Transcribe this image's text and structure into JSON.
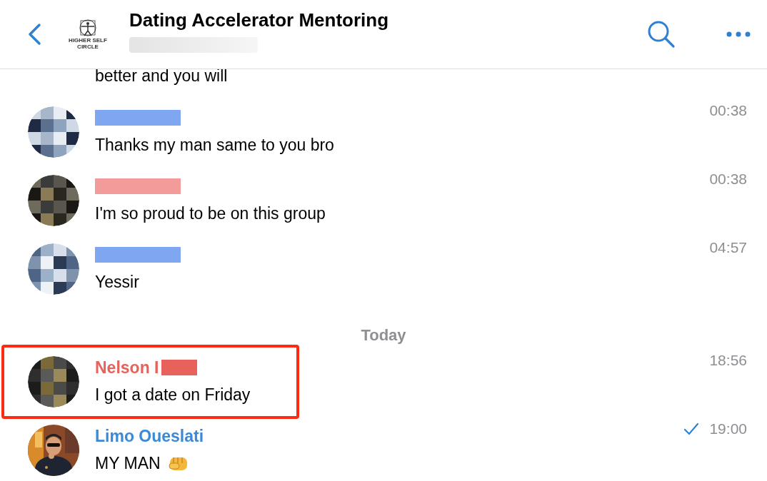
{
  "header": {
    "title": "Dating Accelerator Mentoring",
    "logo_text": "HIGHER SELF CIRCLE",
    "subtitle_blurred": true
  },
  "messages": [
    {
      "kind": "partial",
      "text": "better and you will"
    },
    {
      "kind": "message",
      "name_blurred": true,
      "color": "#7fa6f0",
      "text": "Thanks my man same to you bro",
      "time": "00:38",
      "highlighted": false,
      "read": false
    },
    {
      "kind": "message",
      "name_blurred": true,
      "color": "#f39a9a",
      "text": "I'm so proud to be on this group",
      "time": "00:38",
      "highlighted": false,
      "read": false
    },
    {
      "kind": "message",
      "name_blurred": true,
      "color": "#7fa6f0",
      "text": "Yessir",
      "time": "04:57",
      "highlighted": false,
      "read": false
    },
    {
      "kind": "date",
      "text": "Today"
    },
    {
      "kind": "message",
      "name": "Nelson I",
      "name_blurred": true,
      "color": "#e8615a",
      "text": "I got a date on Friday",
      "time": "18:56",
      "highlighted": true,
      "read": false
    },
    {
      "kind": "message",
      "name": "Limo Oueslati",
      "name_blurred": false,
      "color": "#3a8ad6",
      "text": "MY MAN",
      "has_emoji": true,
      "time": "19:00",
      "highlighted": false,
      "read": true
    }
  ]
}
